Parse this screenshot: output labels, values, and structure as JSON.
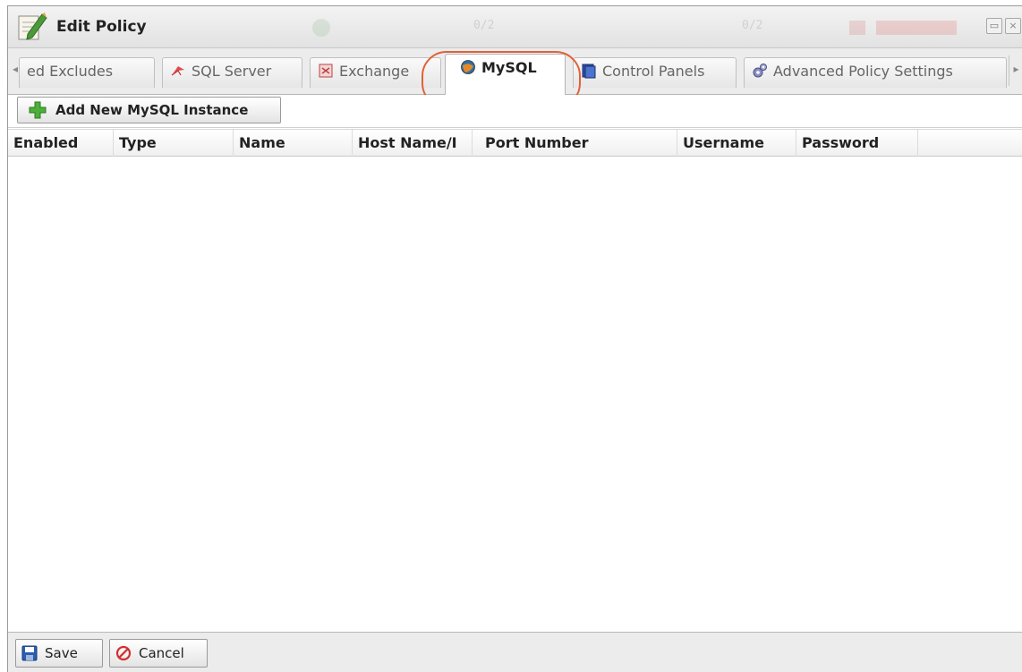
{
  "window": {
    "title": "Edit Policy"
  },
  "tabs": [
    {
      "label": "ed Excludes",
      "icon": "arrow-left-icon",
      "active": false
    },
    {
      "label": "SQL Server",
      "icon": "sql-server-icon",
      "active": false
    },
    {
      "label": "Exchange",
      "icon": "exchange-icon",
      "active": false
    },
    {
      "label": "MySQL",
      "icon": "mysql-icon",
      "active": true
    },
    {
      "label": "Control Panels",
      "icon": "control-panels-icon",
      "active": false
    },
    {
      "label": "Advanced Policy Settings",
      "icon": "gears-icon",
      "active": false
    }
  ],
  "toolbar": {
    "add_label": "Add New MySQL Instance"
  },
  "grid": {
    "columns": [
      "Enabled",
      "Type",
      "Name",
      "Host Name/I",
      "Port Number",
      "Username",
      "Password"
    ],
    "rows": []
  },
  "footer": {
    "save_label": "Save",
    "cancel_label": "Cancel"
  },
  "colors": {
    "highlight_ring": "#e0623a",
    "add_icon": "#4caf3a",
    "cancel_icon": "#d23030",
    "save_icon": "#2a5fb0"
  }
}
